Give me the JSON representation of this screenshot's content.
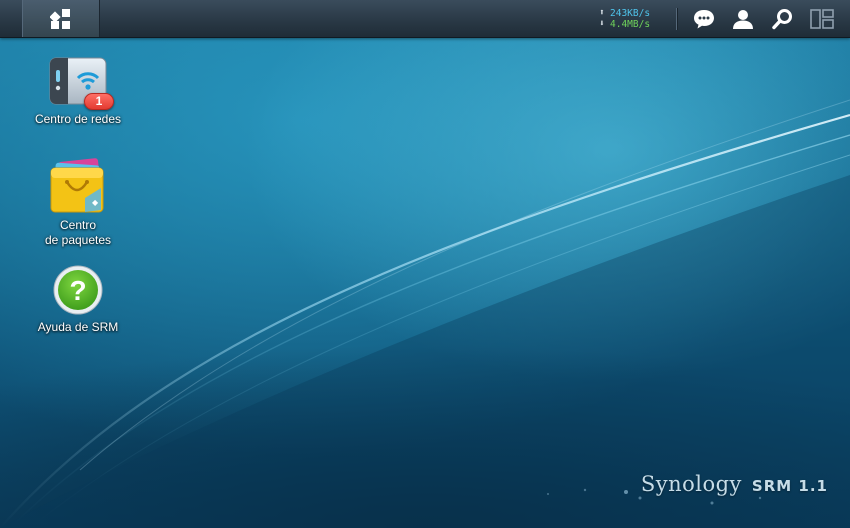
{
  "taskbar": {
    "main_menu_icon": "grid-menu-icon",
    "upload_speed": "243KB/s",
    "download_speed": "4.4MB/s",
    "buttons": [
      {
        "icon": "chat-bubble-icon"
      },
      {
        "icon": "user-icon"
      },
      {
        "icon": "search-icon"
      },
      {
        "icon": "widgets-icon"
      }
    ]
  },
  "desktop": {
    "apps": [
      {
        "label": "Centro de redes",
        "icon": "network-center-icon",
        "badge": "1"
      },
      {
        "label": "Centro\nde paquetes",
        "icon": "package-center-icon"
      },
      {
        "label": "Ayuda de SRM",
        "icon": "help-icon"
      }
    ]
  },
  "brand": {
    "name": "Synology",
    "product": "SRM 1.1"
  },
  "colors": {
    "upload": "#4fc3ea",
    "download": "#6fd25a",
    "badge": "#e33b31",
    "taskbar": "#2a3946"
  }
}
